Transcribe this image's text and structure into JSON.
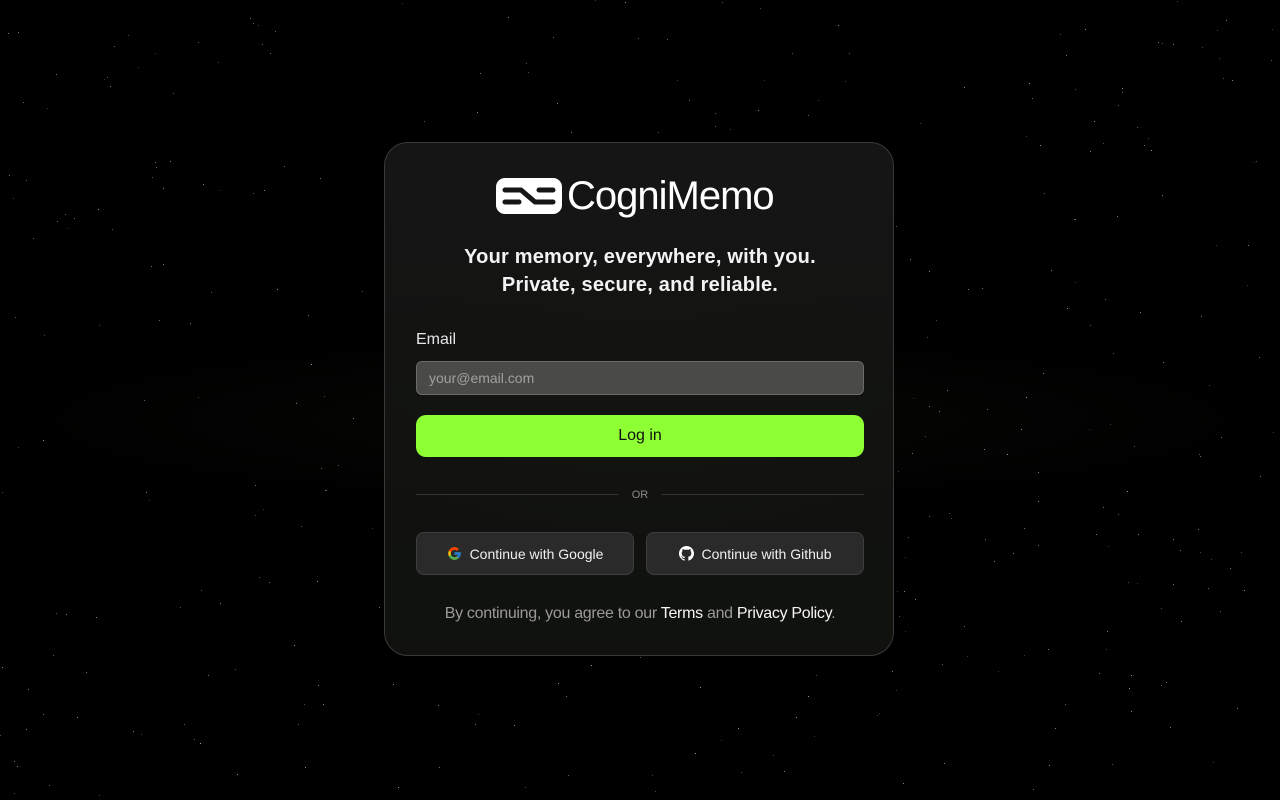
{
  "app": {
    "name": "CogniMemo"
  },
  "tagline": {
    "line1": "Your memory, everywhere, with you.",
    "line2": "Private, secure, and reliable."
  },
  "form": {
    "email_label": "Email",
    "email_placeholder": "your@email.com",
    "email_value": "",
    "login_label": "Log in"
  },
  "divider": {
    "label": "OR"
  },
  "oauth": {
    "google_label": "Continue with Google",
    "github_label": "Continue with Github"
  },
  "legal": {
    "prefix": "By continuing, you agree to our",
    "terms": "Terms",
    "and": "and",
    "privacy": "Privacy Policy",
    "suffix": "."
  },
  "colors": {
    "accent": "#8eff33",
    "background": "#000000",
    "card": "#161616"
  },
  "icons": {
    "logo": "cognimemo-logo-icon",
    "google": "google-icon",
    "github": "github-icon"
  }
}
